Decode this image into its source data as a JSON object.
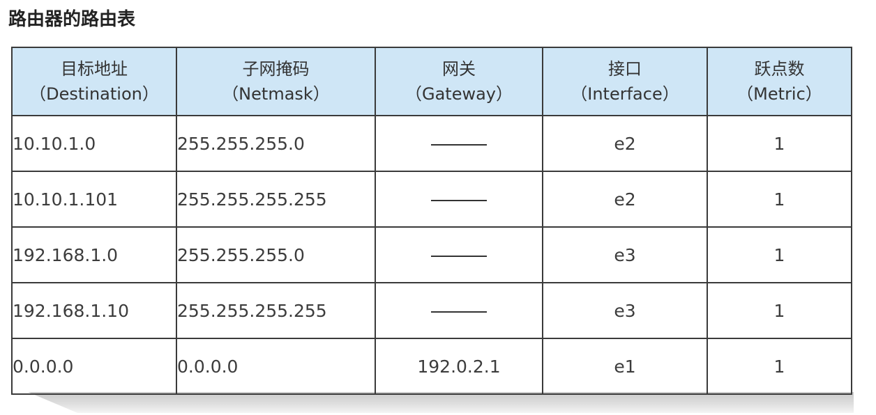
{
  "title": "路由器的路由表",
  "table": {
    "headers": [
      {
        "zh": "目标地址",
        "en": "（Destination）"
      },
      {
        "zh": "子网掩码",
        "en": "（Netmask）"
      },
      {
        "zh": "网关",
        "en": "（Gateway）"
      },
      {
        "zh": "接口",
        "en": "（Interface）"
      },
      {
        "zh": "跃点数",
        "en": "（Metric）"
      }
    ],
    "rows": [
      {
        "destination": "10.10.1.0",
        "netmask": "255.255.255.0",
        "gateway": "——",
        "interface": "e2",
        "metric": "1"
      },
      {
        "destination": "10.10.1.101",
        "netmask": "255.255.255.255",
        "gateway": "——",
        "interface": "e2",
        "metric": "1"
      },
      {
        "destination": "192.168.1.0",
        "netmask": "255.255.255.0",
        "gateway": "——",
        "interface": "e3",
        "metric": "1"
      },
      {
        "destination": "192.168.1.10",
        "netmask": "255.255.255.255",
        "gateway": "——",
        "interface": "e3",
        "metric": "1"
      },
      {
        "destination": "0.0.0.0",
        "netmask": "0.0.0.0",
        "gateway": "192.0.2.1",
        "interface": "e1",
        "metric": "1"
      }
    ]
  }
}
